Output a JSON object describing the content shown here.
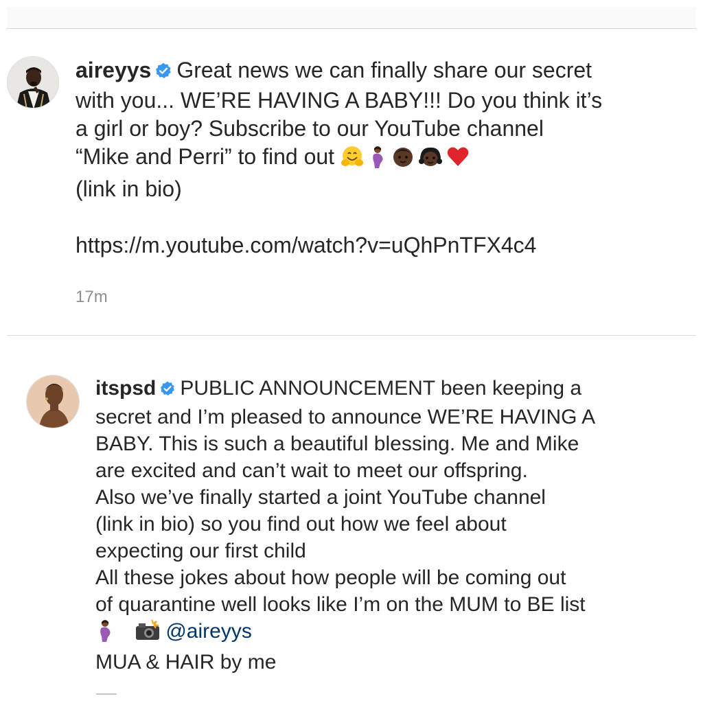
{
  "post1": {
    "username": "aireyys",
    "lines": [
      "Great news we can finally share our secret",
      "with you... WE’RE HAVING A BABY!!! Do you think it’s",
      "a girl or boy? Subscribe to our YouTube channel",
      "“Mike and Perri” to find out",
      "(link in bio)",
      "https://m.youtube.com/watch?v=uQhPnTFX4c4"
    ],
    "emojis": [
      "hugging-face",
      "pregnant-woman",
      "boy",
      "girl",
      "red-heart"
    ],
    "time": "17m"
  },
  "post2": {
    "username": "itspsd",
    "lines": [
      "PUBLIC ANNOUNCEMENT been keeping a",
      "secret and I’m pleased to announce WE’RE HAVING A",
      "BABY. This is such a beautiful blessing. Me and Mike",
      "are excited and can’t wait to meet our offspring.",
      "Also we’ve finally started a joint YouTube channel",
      "(link in bio) so you find out how we feel about",
      "expecting our first child",
      "All these jokes about how people will be coming out",
      "of quarantine well looks like I’m on the MUM to BE list",
      "@aireyys",
      "MUA & HAIR by me"
    ],
    "emojis": [
      "pregnant-woman",
      "camera-with-flash"
    ]
  },
  "colors": {
    "text": "#262626",
    "verified": "#3897f0",
    "mention": "#00376b",
    "meta": "#8e8e8e"
  }
}
